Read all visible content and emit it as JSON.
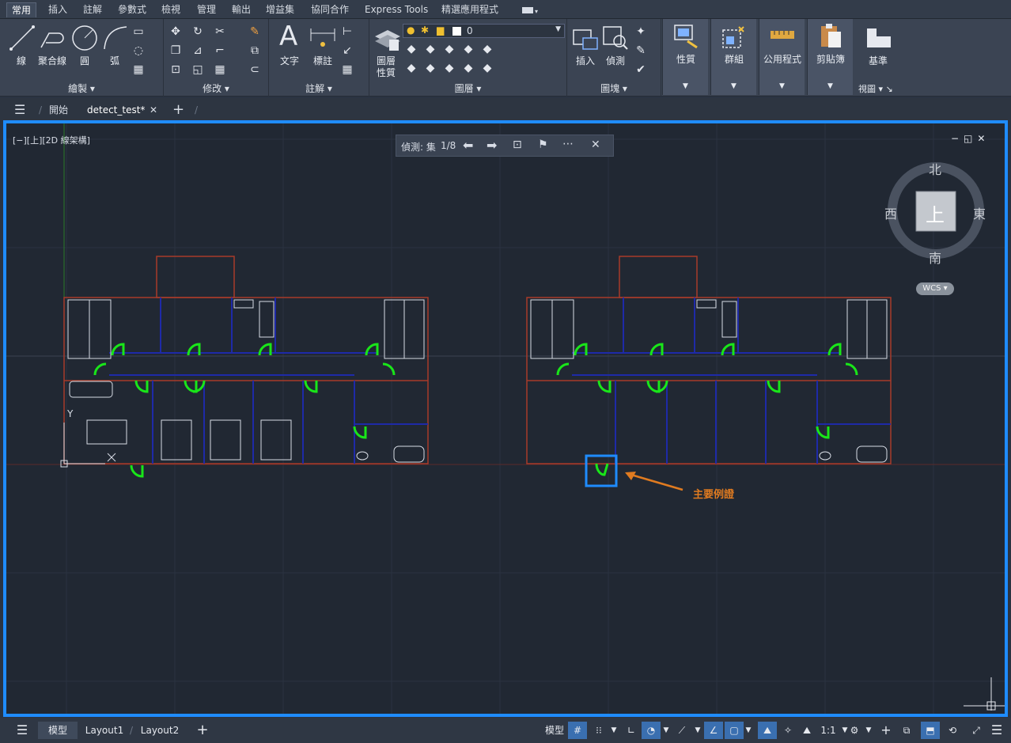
{
  "menu_tabs": [
    "常用",
    "插入",
    "註解",
    "參數式",
    "檢視",
    "管理",
    "輸出",
    "增益集",
    "協同合作",
    "Express Tools",
    "精選應用程式"
  ],
  "ribbon": {
    "draw": {
      "title": "繪製 ▾",
      "line": "線",
      "polyline": "聚合線",
      "circle": "圓",
      "arc": "弧"
    },
    "modify": {
      "title": "修改 ▾"
    },
    "annotation": {
      "title": "註解 ▾",
      "text": "文字",
      "dimension": "標註"
    },
    "layers": {
      "title": "圖層 ▾",
      "properties_l1": "圖層",
      "properties_l2": "性質",
      "current_layer": "0"
    },
    "block": {
      "title": "圖塊 ▾",
      "insert": "插入",
      "detect": "偵測"
    },
    "properties": "性質",
    "groups": "群組",
    "utilities": "公用程式",
    "clipboard": "剪貼簿",
    "view": {
      "title": "視圖 ▾ ↘",
      "base": "基準"
    }
  },
  "doc_tabs": {
    "start": "開始",
    "file": "detect_test*",
    "new_tab": "+"
  },
  "viewport": {
    "label": "[−][上][2D 線架構]",
    "detect_toolbar": {
      "label": "偵測: 集",
      "count": "1/8"
    },
    "viewcube": {
      "north": "北",
      "south": "南",
      "east": "東",
      "west": "西",
      "face": "上",
      "wcs": "WCS"
    },
    "ucs": {
      "y": "Y",
      "x": "X"
    },
    "annotation_text": "主要例證",
    "colors": {
      "door": "#19e619",
      "wall": "#1e2aa8",
      "outline": "#a83a2a",
      "highlight": "#1f8cff",
      "arrow": "#e07b20"
    }
  },
  "status_tabs": {
    "model": "模型",
    "layout1": "Layout1",
    "layout2": "Layout2",
    "add": "+"
  },
  "status_bar": {
    "model": "模型",
    "scale": "1:1"
  }
}
